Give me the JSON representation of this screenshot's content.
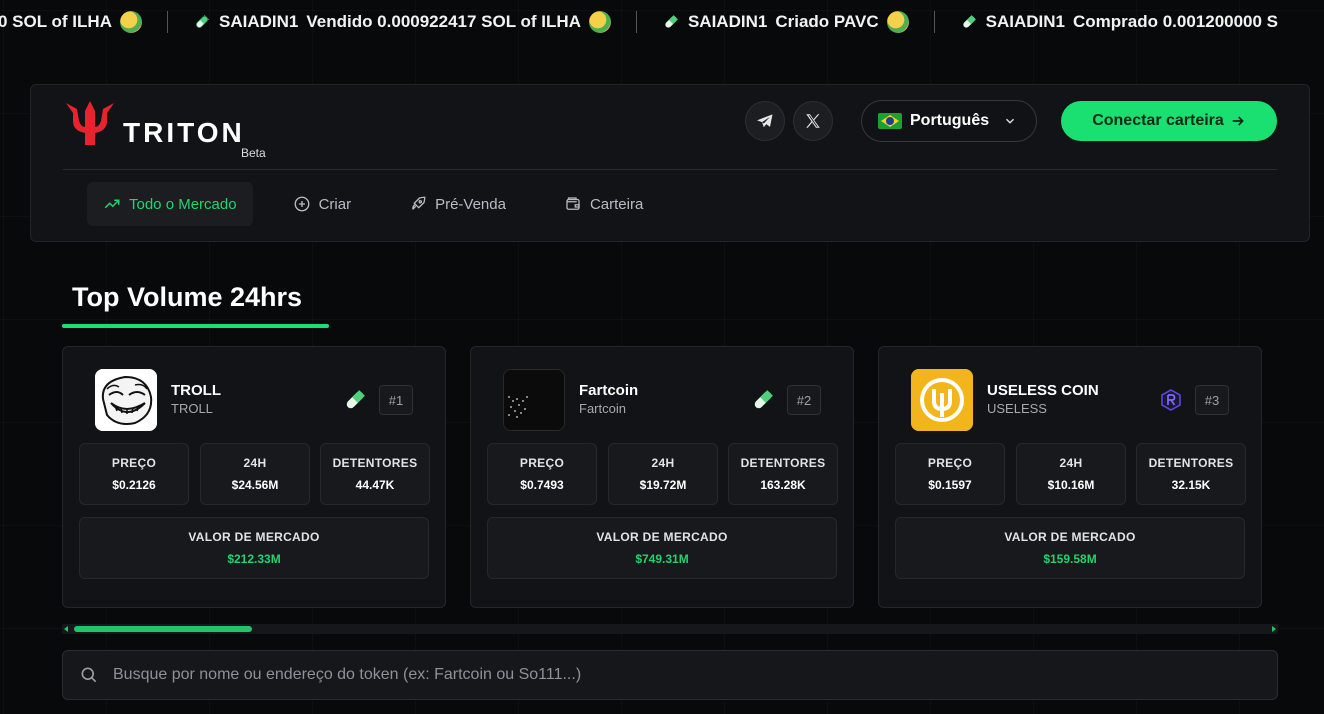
{
  "ticker": {
    "items": [
      {
        "text": "0 SOL of  ILHA",
        "has_pill": false,
        "has_emoji": true
      },
      {
        "user": "SAIADIN1",
        "text": "Vendido 0.000922417 SOL of  ILHA",
        "has_pill": true,
        "has_emoji": true
      },
      {
        "user": "SAIADIN1",
        "text": "Criado  PAVC",
        "has_pill": true,
        "has_emoji": true
      },
      {
        "user": "SAIADIN1",
        "text": "Comprado 0.001200000 S",
        "has_pill": true,
        "has_emoji": false
      }
    ]
  },
  "header": {
    "logo_text": "TRITON",
    "logo_badge": "Beta",
    "social": [
      {
        "name": "telegram-icon"
      },
      {
        "name": "x-icon"
      }
    ],
    "language": "Português",
    "connect_label": "Conectar carteira",
    "nav": [
      {
        "label": "Todo o Mercado",
        "icon": "trending-up-icon",
        "active": true
      },
      {
        "label": "Criar",
        "icon": "plus-circle-icon",
        "active": false
      },
      {
        "label": "Pré-Venda",
        "icon": "rocket-icon",
        "active": false
      },
      {
        "label": "Carteira",
        "icon": "wallet-icon",
        "active": false
      }
    ]
  },
  "section": {
    "title": "Top Volume 24hrs"
  },
  "labels": {
    "price": "PREÇO",
    "vol24": "24H",
    "holders": "DETENTORES",
    "mcap": "VALOR DE MERCADO"
  },
  "tokens": [
    {
      "name": "TROLL",
      "symbol": "TROLL",
      "rank": "#1",
      "chain": "pill-icon",
      "price": "$0.2126",
      "vol24": "$24.56M",
      "holders": "44.47K",
      "mcap": "$212.33M"
    },
    {
      "name": "Fartcoin",
      "symbol": "Fartcoin",
      "rank": "#2",
      "chain": "pill-icon",
      "price": "$0.7493",
      "vol24": "$19.72M",
      "holders": "163.28K",
      "mcap": "$749.31M"
    },
    {
      "name": "USELESS COIN",
      "symbol": "USELESS",
      "rank": "#3",
      "chain": "raydium-icon",
      "price": "$0.1597",
      "vol24": "$10.16M",
      "holders": "32.15K",
      "mcap": "$159.58M"
    }
  ],
  "scroll": {
    "position": 0.0
  },
  "search": {
    "placeholder": "Busque por nome ou endereço do token (ex: Fartcoin ou So111...)",
    "value": ""
  },
  "colors": {
    "accent": "#1ae072",
    "logo_red": "#e8232d",
    "background": "#08090a",
    "card": "#121316"
  }
}
